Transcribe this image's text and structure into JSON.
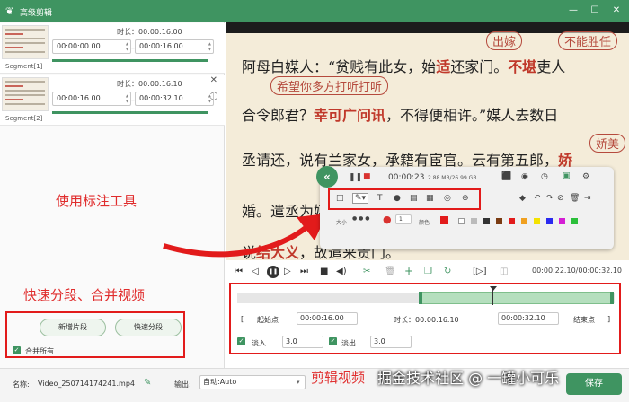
{
  "window": {
    "title": "高级剪辑",
    "icon": "app-logo-icon",
    "controls": [
      "_",
      "□",
      "✕"
    ]
  },
  "segments": [
    {
      "label": "Segment[1]",
      "duration": "时长：00:00:16.00",
      "start": "00:00:00.00",
      "end": "00:00:16.00"
    },
    {
      "label": "Segment[2]",
      "duration": "时长：00:00:16.10",
      "start": "00:00:16.00",
      "end": "00:00:32.10"
    }
  ],
  "left_actions": {
    "new_segment": "新增片段",
    "quick_split": "快速分段",
    "merge_all": "合并所有"
  },
  "annotations": {
    "left": "快速分段、合并视频",
    "toolbar": "使用标注工具",
    "timeline": "剪辑视频"
  },
  "preview": {
    "lines": [
      {
        "pre": "阿母白媒人：“贫贱有此女，始",
        "red": "适",
        "mid": "还家门。",
        "red2": "不堪",
        "post": "吏人"
      },
      {
        "pre": "合令郎君？",
        "red": "幸可广问讯",
        "mid": "，不得便相许。”媒人去数日",
        "red2": "",
        "post": ""
      },
      {
        "pre": "丞请还，说有兰家女，承籍有宦官。云有第五郎，",
        "red": "娇",
        "mid": "",
        "red2": "",
        "post": ""
      },
      {
        "pre": "婚。遣丞为媒",
        "red": "",
        "mid": "",
        "red2": "",
        "post": ""
      },
      {
        "pre": "说",
        "red": "结大义",
        "mid": "，故遣来贵门。",
        "red2": "",
        "post": ""
      }
    ],
    "handnotes": [
      "出嫁",
      "不能胜任",
      "希望你多方打听打听",
      "娇美"
    ]
  },
  "toolbar": {
    "record_time": "00:00:23",
    "storage": "2.88 MB/26.99 GB",
    "size_label": "大小",
    "size_value": "1",
    "color_label": "颜色"
  },
  "player": {
    "time_readout": "00:00:22.10/00:00:32.10"
  },
  "edit": {
    "start_btn": "起始点",
    "start_time": "00:00:16.00",
    "duration": "时长：00:00:16.10",
    "end_time": "00:00:32.10",
    "end_btn": "结束点",
    "fade_in_label": "淡入",
    "fade_in_value": "3.0",
    "fade_out_label": "淡出",
    "fade_out_value": "3.0"
  },
  "bottom": {
    "name_label": "名称:",
    "name_value": "Video_250714174241.mp4",
    "output_label": "输出:",
    "output_value": "自动:Auto",
    "watermark": "掘金技术社区 @ 一罐小可乐",
    "save_btn": "保存"
  },
  "colors": {
    "brand": "#3f9461",
    "annotation_red": "#e21b1b"
  }
}
